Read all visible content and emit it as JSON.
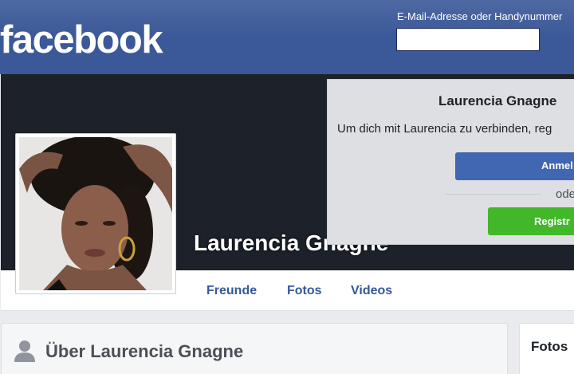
{
  "header": {
    "logo": "facebook",
    "login_label": "E-Mail-Adresse oder Handynummer",
    "login_value": ""
  },
  "profile": {
    "name": "Laurencia Gnagne"
  },
  "tabs": [
    "Freunde",
    "Fotos",
    "Videos"
  ],
  "overlay": {
    "title": "Laurencia Gnagne",
    "text": "Um dich mit Laurencia zu verbinden, reg",
    "login_button": "Anmel",
    "or": "ode",
    "register_button": "Registr"
  },
  "about": {
    "title": "Über Laurencia Gnagne"
  },
  "photos": {
    "title": "Fotos"
  },
  "colors": {
    "brand_blue": "#3b5998",
    "link_blue": "#365899",
    "button_blue": "#4267b2",
    "register_green": "#42b72a"
  }
}
